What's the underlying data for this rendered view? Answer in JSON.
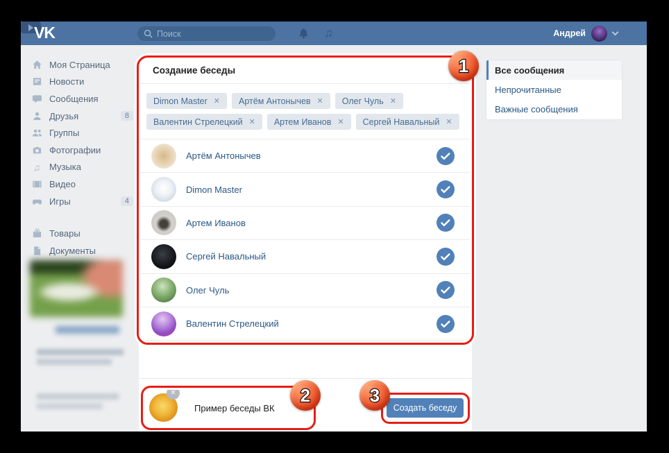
{
  "colors": {
    "vk_blue": "#4c73a2",
    "search_bg": "#3f648f",
    "accent_blue": "#5181b8",
    "link_blue": "#2a5885",
    "page_bg": "#edeef0",
    "annotation_red": "#e71d16",
    "chip_bg": "#e1e7ed",
    "chip_text": "#4a6b93"
  },
  "topbar": {
    "logo": "VK",
    "search_placeholder": "Поиск",
    "user_name": "Андрей",
    "avatar_css": "radial-gradient(circle at 50% 35%, #9a6ec0 0%, #5d3b8a 45%, #2e1d4e 80%, #1e1433 100%)"
  },
  "sidebar": {
    "items": [
      {
        "icon": "home",
        "label": "Моя Страница",
        "badge": ""
      },
      {
        "icon": "news",
        "label": "Новости",
        "badge": ""
      },
      {
        "icon": "messages",
        "label": "Сообщения",
        "badge": ""
      },
      {
        "icon": "friends",
        "label": "Друзья",
        "badge": "8"
      },
      {
        "icon": "groups",
        "label": "Группы",
        "badge": ""
      },
      {
        "icon": "photos",
        "label": "Фотографии",
        "badge": ""
      },
      {
        "icon": "music",
        "label": "Музыка",
        "badge": ""
      },
      {
        "icon": "video",
        "label": "Видео",
        "badge": ""
      },
      {
        "icon": "games",
        "label": "Игры",
        "badge": "4"
      },
      {
        "icon": "market",
        "label": "Товары",
        "badge": ""
      },
      {
        "icon": "docs",
        "label": "Документы",
        "badge": ""
      }
    ]
  },
  "main": {
    "title": "Создание беседы",
    "chips": [
      {
        "label": "Dimon Master"
      },
      {
        "label": "Артём Антонычев"
      },
      {
        "label": "Олег Чуль"
      },
      {
        "label": "Валентин Стрелецкий"
      },
      {
        "label": "Артем Иванов"
      },
      {
        "label": "Сергей Навальный"
      }
    ],
    "members": [
      {
        "name": "Артём Антонычев",
        "selected": true,
        "avatar_css": "radial-gradient(circle at 50% 50%, #d8b88a 0%, #e7d3b2 45%, #f3eee5 90%)"
      },
      {
        "name": "Dimon Master",
        "selected": true,
        "avatar_css": "radial-gradient(circle at 50% 45%, #ffffff 0%, #eef2f6 40%, #ccd7e3 80%, #becbdb 100%)"
      },
      {
        "name": "Артем Иванов",
        "selected": true,
        "avatar_css": "radial-gradient(circle at 50% 55%, #44403a 0%, #44403a 20%, #d3d1cd 42%, #c7c5c0 100%)"
      },
      {
        "name": "Сергей Навальный",
        "selected": true,
        "avatar_css": "radial-gradient(circle at 45% 40%, #3a3f46 0%, #16181c 55%, #000000 100%)"
      },
      {
        "name": "Олег Чуль",
        "selected": true,
        "avatar_css": "radial-gradient(circle at 45% 35%, #cfe3c0 0%, #8cb478 40%, #5a8a4e 75%, #47703f 100%)"
      },
      {
        "name": "Валентин Стрелецкий",
        "selected": true,
        "avatar_css": "radial-gradient(circle at 45% 30%, #e3c7ef 0%, #b887dd 35%, #8f4ec5 65%, #c934a6 100%)"
      }
    ],
    "footer": {
      "conversation_name": "Пример беседы ВК",
      "create_button": "Создать беседу",
      "photo_css": "radial-gradient(circle at 48% 45%, #f8d96b 0%, #f0b63a 40%, #d98c15 75%, #b96f0c 100%)"
    }
  },
  "right_menu": {
    "items": [
      {
        "label": "Все сообщения",
        "active": true
      },
      {
        "label": "Непрочитанные",
        "active": false
      },
      {
        "label": "Важные сообщения",
        "active": false
      }
    ]
  },
  "annotations": {
    "step1": "1",
    "step2": "2",
    "step3": "3"
  },
  "ui": {
    "close_glyph": "✕",
    "music_glyph": "♫"
  }
}
